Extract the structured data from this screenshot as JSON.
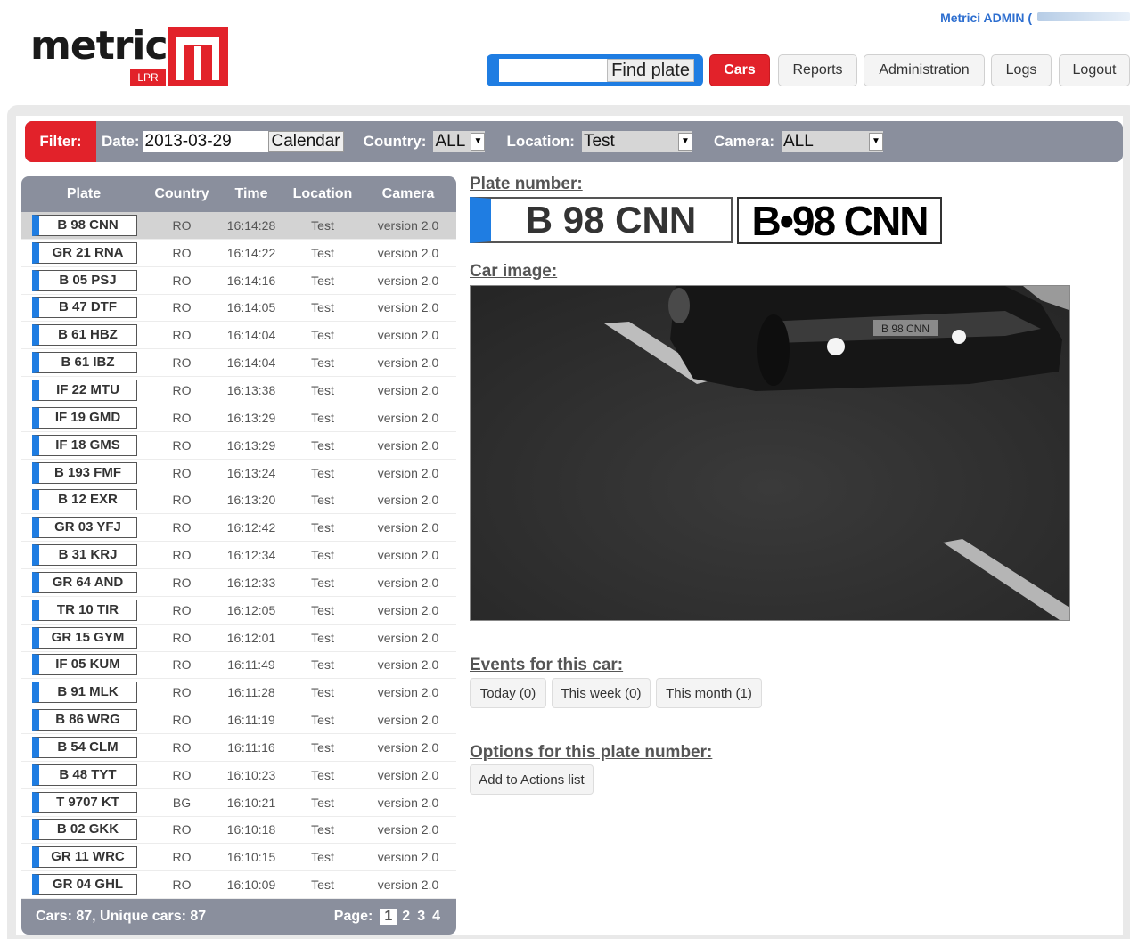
{
  "header": {
    "logo_text": "metricí",
    "logo_badge": "LPR",
    "user_label": "Metrici ADMIN (",
    "find_plate_label": "Find plate",
    "nav": [
      "Cars",
      "Reports",
      "Administration",
      "Logs",
      "Logout"
    ],
    "active_nav": "Cars"
  },
  "filter": {
    "tag": "Filter:",
    "date_label": "Date:",
    "date_value": "2013-03-29",
    "calendar_label": "Calendar",
    "country_label": "Country:",
    "country_value": "ALL",
    "location_label": "Location:",
    "location_value": "Test",
    "camera_label": "Camera:",
    "camera_value": "ALL"
  },
  "table": {
    "columns": [
      "Plate",
      "Country",
      "Time",
      "Location",
      "Camera"
    ],
    "rows": [
      [
        "B 98 CNN",
        "RO",
        "16:14:28",
        "Test",
        "version 2.0"
      ],
      [
        "GR 21 RNA",
        "RO",
        "16:14:22",
        "Test",
        "version 2.0"
      ],
      [
        "B 05 PSJ",
        "RO",
        "16:14:16",
        "Test",
        "version 2.0"
      ],
      [
        "B 47 DTF",
        "RO",
        "16:14:05",
        "Test",
        "version 2.0"
      ],
      [
        "B 61 HBZ",
        "RO",
        "16:14:04",
        "Test",
        "version 2.0"
      ],
      [
        "B 61 IBZ",
        "RO",
        "16:14:04",
        "Test",
        "version 2.0"
      ],
      [
        "IF 22 MTU",
        "RO",
        "16:13:38",
        "Test",
        "version 2.0"
      ],
      [
        "IF 19 GMD",
        "RO",
        "16:13:29",
        "Test",
        "version 2.0"
      ],
      [
        "IF 18 GMS",
        "RO",
        "16:13:29",
        "Test",
        "version 2.0"
      ],
      [
        "B 193 FMF",
        "RO",
        "16:13:24",
        "Test",
        "version 2.0"
      ],
      [
        "B 12 EXR",
        "RO",
        "16:13:20",
        "Test",
        "version 2.0"
      ],
      [
        "GR 03 YFJ",
        "RO",
        "16:12:42",
        "Test",
        "version 2.0"
      ],
      [
        "B 31 KRJ",
        "RO",
        "16:12:34",
        "Test",
        "version 2.0"
      ],
      [
        "GR 64 AND",
        "RO",
        "16:12:33",
        "Test",
        "version 2.0"
      ],
      [
        "TR 10 TIR",
        "RO",
        "16:12:05",
        "Test",
        "version 2.0"
      ],
      [
        "GR 15 GYM",
        "RO",
        "16:12:01",
        "Test",
        "version 2.0"
      ],
      [
        "IF 05 KUM",
        "RO",
        "16:11:49",
        "Test",
        "version 2.0"
      ],
      [
        "B 91 MLK",
        "RO",
        "16:11:28",
        "Test",
        "version 2.0"
      ],
      [
        "B 86 WRG",
        "RO",
        "16:11:19",
        "Test",
        "version 2.0"
      ],
      [
        "B 54 CLM",
        "RO",
        "16:11:16",
        "Test",
        "version 2.0"
      ],
      [
        "B 48 TYT",
        "RO",
        "16:10:23",
        "Test",
        "version 2.0"
      ],
      [
        "T 9707 KT",
        "BG",
        "16:10:21",
        "Test",
        "version 2.0"
      ],
      [
        "B 02 GKK",
        "RO",
        "16:10:18",
        "Test",
        "version 2.0"
      ],
      [
        "GR 11 WRC",
        "RO",
        "16:10:15",
        "Test",
        "version 2.0"
      ],
      [
        "GR 04 GHL",
        "RO",
        "16:10:09",
        "Test",
        "version 2.0"
      ]
    ],
    "selected_index": 0,
    "footer_summary": "Cars: 87, Unique cars: 87",
    "page_label": "Page:",
    "pages": [
      "1",
      "2",
      "3",
      "4"
    ],
    "current_page": "1"
  },
  "detail": {
    "plate_number_title": "Plate number:",
    "plate_number": "B 98 CNN",
    "plate_crop_text": "B•98 CNN",
    "car_image_title": "Car image:",
    "car_image_plate": "B 98 CNN",
    "events_title": "Events for this car:",
    "events": [
      "Today (0)",
      "This week (0)",
      "This month (1)"
    ],
    "options_title": "Options for this plate number:",
    "add_action_label": "Add to Actions list"
  },
  "colors": {
    "brand_red": "#e2222a",
    "accent_blue": "#1f7de2",
    "bar_gray": "#8a8f9d"
  }
}
